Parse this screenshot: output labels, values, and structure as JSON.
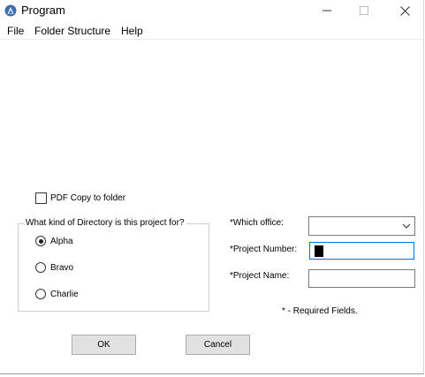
{
  "window": {
    "title": "Program",
    "icon": "app-icon"
  },
  "menu": {
    "items": [
      "File",
      "Folder Structure",
      "Help"
    ]
  },
  "form": {
    "pdf_copy_label": "PDF Copy to folder",
    "pdf_copy_checked": false,
    "directory_group_title": "What kind of Directory is this project for?",
    "directory_options": [
      {
        "label": "Alpha",
        "selected": true
      },
      {
        "label": "Bravo",
        "selected": false
      },
      {
        "label": "Charlie",
        "selected": false
      }
    ],
    "office_label": "*Which office:",
    "office_value": "",
    "project_number_label": "*Project Number:",
    "project_number_value": "",
    "project_name_label": "*Project Name:",
    "project_name_value": "",
    "required_note": "* - Required Fields."
  },
  "buttons": {
    "ok": "OK",
    "cancel": "Cancel"
  },
  "colors": {
    "focus_border": "#0078d7",
    "button_bg": "#e1e1e1"
  }
}
